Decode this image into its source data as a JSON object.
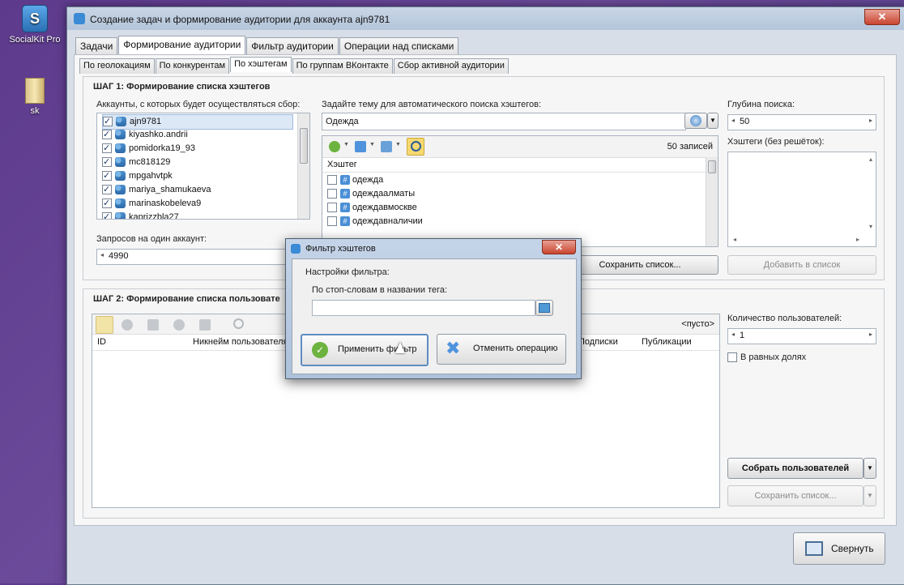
{
  "desktop": {
    "icons": [
      {
        "label": "SocialKit Pro"
      },
      {
        "label": "sk"
      }
    ]
  },
  "window": {
    "title": "Создание задач и формирование аудитории для аккаунта ajn9781",
    "close_label": "✕"
  },
  "main_tabs": [
    "Задачи",
    "Формирование аудитории",
    "Фильтр аудитории",
    "Операции над списками"
  ],
  "sub_tabs": [
    "По геолокациям",
    "По конкурентам",
    "По хэштегам",
    "По группам ВКонтакте",
    "Сбор активной аудитории"
  ],
  "step1": {
    "title": "ШАГ 1: Формирование списка хэштегов",
    "accounts_label": "Аккаунты, с которых будет осуществляться сбор:",
    "accounts": [
      "ajn9781",
      "kiyashko.andrii",
      "pomidorka19_93",
      "mc818129",
      "mpgahvtpk",
      "mariya_shamukaeva",
      "marinaskobeleva9",
      "kaprizzbla27"
    ],
    "requests_label": "Запросов на один аккаунт:",
    "requests_value": "4990",
    "topic_label": "Задайте тему для автоматического поиска хэштегов:",
    "topic_value": "Одежда",
    "records_count": "50 записей",
    "hashtag_col": "Хэштег",
    "hashtags": [
      "одежда",
      "одеждаалматы",
      "одеждавмоскве",
      "одеждавналичии"
    ],
    "save_list": "Сохранить список...",
    "depth_label": "Глубина поиска:",
    "depth_value": "50",
    "hashtags_label": "Хэштеги (без решёток):",
    "add_to_list": "Добавить в список"
  },
  "step2": {
    "title": "ШАГ 2: Формирование списка пользовате",
    "empty_label": "<пусто>",
    "columns": [
      "ID",
      "Никнейм пользователя",
      "Подписки",
      "Публикации"
    ],
    "users_count_label": "Количество пользователей:",
    "users_count_value": "1",
    "equal_shares": "В равных долях",
    "collect_users": "Собрать пользователей",
    "save_list": "Сохранить список..."
  },
  "minimize": "Свернуть",
  "dialog": {
    "title": "Фильтр хэштегов",
    "settings_label": "Настройки фильтра:",
    "stopwords_label": "По стоп-словам в названии тега:",
    "stopwords_value": "",
    "apply": "Применить фильтр",
    "cancel": "Отменить операцию"
  },
  "colors": {
    "accent": "#3a8ad6",
    "close": "#c9462f",
    "desktop": "#5d3a8c"
  }
}
